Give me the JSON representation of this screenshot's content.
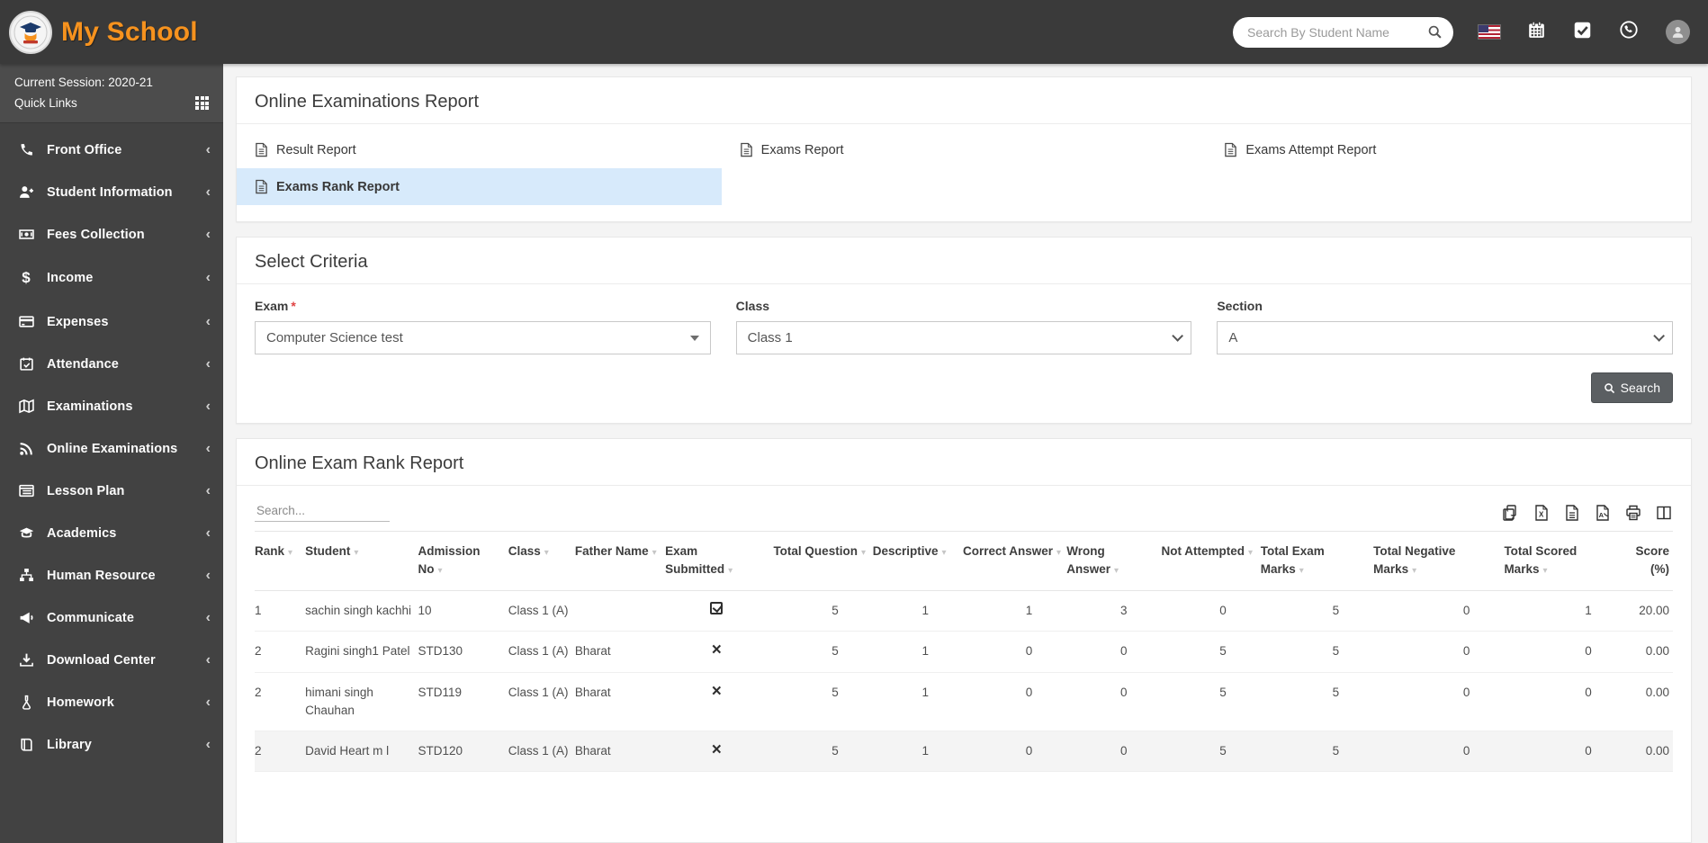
{
  "header": {
    "brand": "My School",
    "search_placeholder": "Search By Student Name",
    "icons": [
      "us-flag",
      "calendar",
      "check-square",
      "whatsapp",
      "user-avatar"
    ]
  },
  "sidebar": {
    "session_label": "Current Session: 2020-21",
    "quick_links_label": "Quick Links",
    "items": [
      {
        "label": "Front Office",
        "icon": "phone"
      },
      {
        "label": "Student Information",
        "icon": "user-plus"
      },
      {
        "label": "Fees Collection",
        "icon": "money-bill"
      },
      {
        "label": "Income",
        "icon": "dollar"
      },
      {
        "label": "Expenses",
        "icon": "credit-card"
      },
      {
        "label": "Attendance",
        "icon": "calendar-check"
      },
      {
        "label": "Examinations",
        "icon": "map"
      },
      {
        "label": "Online Examinations",
        "icon": "rss"
      },
      {
        "label": "Lesson Plan",
        "icon": "list"
      },
      {
        "label": "Academics",
        "icon": "graduation-cap"
      },
      {
        "label": "Human Resource",
        "icon": "sitemap"
      },
      {
        "label": "Communicate",
        "icon": "bullhorn"
      },
      {
        "label": "Download Center",
        "icon": "download"
      },
      {
        "label": "Homework",
        "icon": "flask"
      },
      {
        "label": "Library",
        "icon": "book"
      }
    ]
  },
  "page": {
    "title": "Online Examinations Report",
    "report_links": [
      "Result Report",
      "Exams Report",
      "Exams Attempt Report",
      "Exams Rank Report"
    ],
    "active_report": "Exams Rank Report"
  },
  "criteria": {
    "heading": "Select Criteria",
    "fields": [
      {
        "label": "Exam",
        "required": true,
        "value": "Computer Science test"
      },
      {
        "label": "Class",
        "required": false,
        "value": "Class 1"
      },
      {
        "label": "Section",
        "required": false,
        "value": "A"
      }
    ],
    "search_button_label": "Search"
  },
  "rank_report": {
    "heading": "Online Exam Rank Report",
    "search_placeholder": "Search...",
    "export_buttons": [
      "copy",
      "excel",
      "csv",
      "pdf",
      "print",
      "columns"
    ],
    "table": {
      "columns": [
        "Rank",
        "Student",
        "Admission No",
        "Class",
        "Father Name",
        "Exam Submitted",
        "Total Question",
        "Descriptive",
        "Correct Answer",
        "Wrong Answer",
        "Not Attempted",
        "Total Exam Marks",
        "Total Negative Marks",
        "Total Scored Marks",
        "Score (%)"
      ],
      "rows": [
        {
          "rank": "1",
          "student": "sachin singh kachhi",
          "admission_no": "10",
          "class": "Class 1 (A)",
          "father_name": "",
          "exam_submitted": true,
          "total_question": "5",
          "descriptive": "1",
          "correct_answer": "1",
          "wrong_answer": "3",
          "not_attempted": "0",
          "total_exam_marks": "5",
          "total_negative_marks": "0",
          "total_scored_marks": "1",
          "score": "20.00",
          "highlighted": false
        },
        {
          "rank": "2",
          "student": "Ragini singh1 Patel",
          "admission_no": "STD130",
          "class": "Class 1 (A)",
          "father_name": "Bharat",
          "exam_submitted": false,
          "total_question": "5",
          "descriptive": "1",
          "correct_answer": "0",
          "wrong_answer": "0",
          "not_attempted": "5",
          "total_exam_marks": "5",
          "total_negative_marks": "0",
          "total_scored_marks": "0",
          "score": "0.00",
          "highlighted": false
        },
        {
          "rank": "2",
          "student": "himani singh Chauhan",
          "admission_no": "STD119",
          "class": "Class 1 (A)",
          "father_name": "Bharat",
          "exam_submitted": false,
          "total_question": "5",
          "descriptive": "1",
          "correct_answer": "0",
          "wrong_answer": "0",
          "not_attempted": "5",
          "total_exam_marks": "5",
          "total_negative_marks": "0",
          "total_scored_marks": "0",
          "score": "0.00",
          "highlighted": false
        },
        {
          "rank": "2",
          "student": "David Heart m l",
          "admission_no": "STD120",
          "class": "Class 1 (A)",
          "father_name": "Bharat",
          "exam_submitted": false,
          "total_question": "5",
          "descriptive": "1",
          "correct_answer": "0",
          "wrong_answer": "0",
          "not_attempted": "5",
          "total_exam_marks": "5",
          "total_negative_marks": "0",
          "total_scored_marks": "0",
          "score": "0.00",
          "highlighted": true
        }
      ]
    }
  }
}
